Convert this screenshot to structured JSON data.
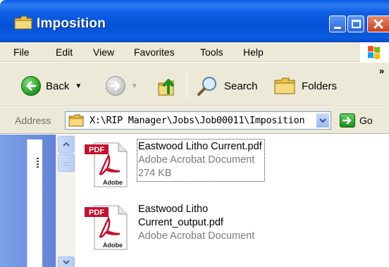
{
  "window": {
    "title": "Imposition",
    "title_icon": "folder-icon"
  },
  "menu": {
    "items": [
      {
        "label": "File"
      },
      {
        "label": "Edit"
      },
      {
        "label": "View"
      },
      {
        "label": "Favorites"
      },
      {
        "label": "Tools"
      },
      {
        "label": "Help"
      }
    ]
  },
  "toolbar": {
    "back_label": "Back",
    "search_label": "Search",
    "folders_label": "Folders",
    "overflow": "»"
  },
  "address": {
    "label": "Address",
    "value": "X:\\RIP Manager\\Jobs\\Job00011\\Imposition",
    "go_label": "Go"
  },
  "files": [
    {
      "name": "Eastwood Litho Current.pdf",
      "type": "Adobe Acrobat Document",
      "size": "274 KB",
      "icon": "pdf-icon",
      "selected": true
    },
    {
      "name_line1": "Eastwood Litho",
      "name_line2": "Current_output.pdf",
      "type": "Adobe Acrobat Document",
      "icon": "pdf-icon",
      "selected": false
    }
  ],
  "icon_labels": {
    "pdf_badge": "PDF",
    "pdf_brand": "Adobe"
  },
  "colors": {
    "titlebar": "#0a5ae0",
    "chrome": "#ece9d8",
    "pdf_red": "#c8102e"
  }
}
